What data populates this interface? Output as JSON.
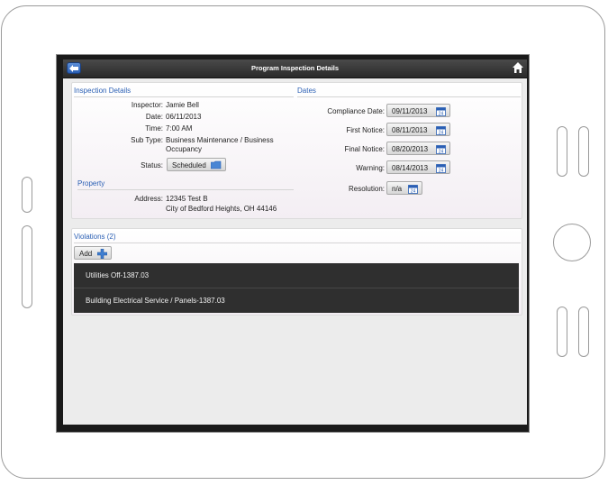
{
  "header": {
    "title": "Program Inspection Details"
  },
  "inspection_details": {
    "heading": "Inspection Details",
    "inspector_label": "Inspector:",
    "inspector": "Jamie Bell",
    "date_label": "Date:",
    "date": "06/11/2013",
    "time_label": "Time:",
    "time": "7:00 AM",
    "subtype_label": "Sub Type:",
    "subtype_line1": "Business Maintenance / Business",
    "subtype_line2": "Occupancy",
    "status_label": "Status:",
    "status": "Scheduled"
  },
  "property": {
    "heading": "Property",
    "address_label": "Address:",
    "address_line1": "12345 Test B",
    "address_line2": "City of Bedford Heights, OH 44146"
  },
  "dates": {
    "heading": "Dates",
    "compliance_label": "Compliance Date:",
    "compliance": "09/11/2013",
    "first_notice_label": "First Notice:",
    "first_notice": "08/11/2013",
    "final_notice_label": "Final Notice:",
    "final_notice": "08/20/2013",
    "warning_label": "Warning:",
    "warning": "08/14/2013",
    "resolution_label": "Resolution:",
    "resolution": "n/a",
    "calendar_day": "24"
  },
  "violations": {
    "heading": "Violations (2)",
    "add_label": "Add",
    "items": [
      {
        "label": "Utilities Off-1387.03"
      },
      {
        "label": "Building Electrical  Service / Panels-1387.03"
      }
    ]
  },
  "colors": {
    "accent": "#2a5fb4",
    "titlebar": "#3a3a3a",
    "row_bg": "#2f2f2f"
  },
  "icons": {
    "back": "back-arrow-icon",
    "home": "home-icon",
    "calendar": "calendar-icon",
    "folder": "folder-icon",
    "add": "plus-icon"
  }
}
